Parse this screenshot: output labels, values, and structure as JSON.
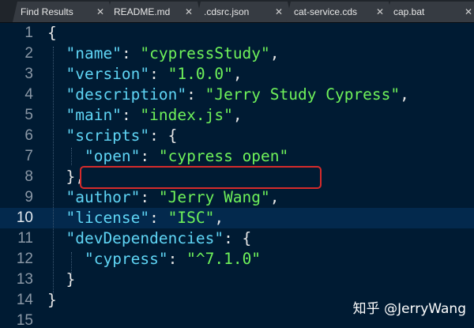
{
  "tabs": [
    {
      "label": "Find Results",
      "close": "✕"
    },
    {
      "label": "README.md",
      "close": "✕"
    },
    {
      "label": ".cdsrc.json",
      "close": "✕"
    },
    {
      "label": "cat-service.cds",
      "close": "✕"
    },
    {
      "label": "cap.bat",
      "close": "✕"
    }
  ],
  "editor": {
    "current_line": 10,
    "lines": [
      {
        "n": "1",
        "parts": [
          {
            "t": "{",
            "c": "p"
          }
        ]
      },
      {
        "n": "2",
        "parts": [
          {
            "t": "  ",
            "c": "p"
          },
          {
            "t": "\"name\"",
            "c": "k"
          },
          {
            "t": ": ",
            "c": "p"
          },
          {
            "t": "\"cypressStudy\"",
            "c": "s"
          },
          {
            "t": ",",
            "c": "p"
          }
        ]
      },
      {
        "n": "3",
        "parts": [
          {
            "t": "  ",
            "c": "p"
          },
          {
            "t": "\"version\"",
            "c": "k"
          },
          {
            "t": ": ",
            "c": "p"
          },
          {
            "t": "\"1.0.0\"",
            "c": "s"
          },
          {
            "t": ",",
            "c": "p"
          }
        ]
      },
      {
        "n": "4",
        "parts": [
          {
            "t": "  ",
            "c": "p"
          },
          {
            "t": "\"description\"",
            "c": "k"
          },
          {
            "t": ": ",
            "c": "p"
          },
          {
            "t": "\"Jerry Study Cypress\"",
            "c": "s"
          },
          {
            "t": ",",
            "c": "p"
          }
        ]
      },
      {
        "n": "5",
        "parts": [
          {
            "t": "  ",
            "c": "p"
          },
          {
            "t": "\"main\"",
            "c": "k"
          },
          {
            "t": ": ",
            "c": "p"
          },
          {
            "t": "\"index.js\"",
            "c": "s"
          },
          {
            "t": ",",
            "c": "p"
          }
        ]
      },
      {
        "n": "6",
        "parts": [
          {
            "t": "  ",
            "c": "p"
          },
          {
            "t": "\"scripts\"",
            "c": "k"
          },
          {
            "t": ": {",
            "c": "p"
          }
        ]
      },
      {
        "n": "7",
        "parts": [
          {
            "t": "    ",
            "c": "p"
          },
          {
            "t": "\"open\"",
            "c": "k"
          },
          {
            "t": ": ",
            "c": "p"
          },
          {
            "t": "\"cypress open\"",
            "c": "s"
          }
        ]
      },
      {
        "n": "8",
        "parts": [
          {
            "t": "  },",
            "c": "p"
          }
        ]
      },
      {
        "n": "9",
        "parts": [
          {
            "t": "  ",
            "c": "p"
          },
          {
            "t": "\"author\"",
            "c": "k"
          },
          {
            "t": ": ",
            "c": "p"
          },
          {
            "t": "\"Jerry Wang\"",
            "c": "s"
          },
          {
            "t": ",",
            "c": "p"
          }
        ]
      },
      {
        "n": "10",
        "parts": [
          {
            "t": "  ",
            "c": "p"
          },
          {
            "t": "\"license\"",
            "c": "k"
          },
          {
            "t": ": ",
            "c": "p"
          },
          {
            "t": "\"ISC\"",
            "c": "s"
          },
          {
            "t": ",",
            "c": "p"
          }
        ]
      },
      {
        "n": "11",
        "parts": [
          {
            "t": "  ",
            "c": "p"
          },
          {
            "t": "\"devDependencies\"",
            "c": "k"
          },
          {
            "t": ": {",
            "c": "p"
          }
        ]
      },
      {
        "n": "12",
        "parts": [
          {
            "t": "    ",
            "c": "p"
          },
          {
            "t": "\"cypress\"",
            "c": "k"
          },
          {
            "t": ": ",
            "c": "p"
          },
          {
            "t": "\"^7.1.0\"",
            "c": "s"
          }
        ]
      },
      {
        "n": "13",
        "parts": [
          {
            "t": "  }",
            "c": "p"
          }
        ]
      },
      {
        "n": "14",
        "parts": [
          {
            "t": "}",
            "c": "p"
          }
        ]
      },
      {
        "n": "15",
        "parts": []
      }
    ]
  },
  "watermark": "知乎 @JerryWang",
  "colors": {
    "background": "#001b33",
    "key": "#5fd5f5",
    "string": "#6ff25a",
    "highlight_box": "#d52b2b"
  }
}
